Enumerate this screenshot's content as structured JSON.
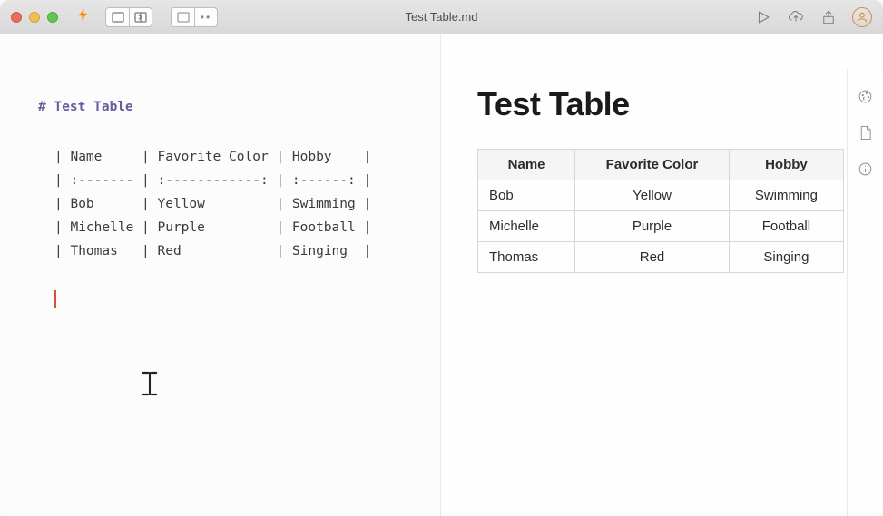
{
  "titlebar": {
    "filename": "Test Table.md"
  },
  "editor": {
    "heading": "# Test Table",
    "line1": "| Name     | Favorite Color | Hobby    |",
    "line2": "| :------- | :------------: | :------: |",
    "line3": "| Bob      | Yellow         | Swimming |",
    "line4": "| Michelle | Purple         | Football |",
    "line5": "| Thomas   | Red            | Singing  |"
  },
  "preview": {
    "title": "Test Table",
    "headers": {
      "col1": "Name",
      "col2": "Favorite Color",
      "col3": "Hobby"
    },
    "rows": {
      "r1c1": "Bob",
      "r1c2": "Yellow",
      "r1c3": "Swimming",
      "r2c1": "Michelle",
      "r2c2": "Purple",
      "r2c3": "Football",
      "r3c1": "Thomas",
      "r3c2": "Red",
      "r3c3": "Singing"
    }
  },
  "chart_data": {
    "type": "table",
    "title": "Test Table",
    "headers": [
      "Name",
      "Favorite Color",
      "Hobby"
    ],
    "rows": [
      [
        "Bob",
        "Yellow",
        "Swimming"
      ],
      [
        "Michelle",
        "Purple",
        "Football"
      ],
      [
        "Thomas",
        "Red",
        "Singing"
      ]
    ]
  }
}
